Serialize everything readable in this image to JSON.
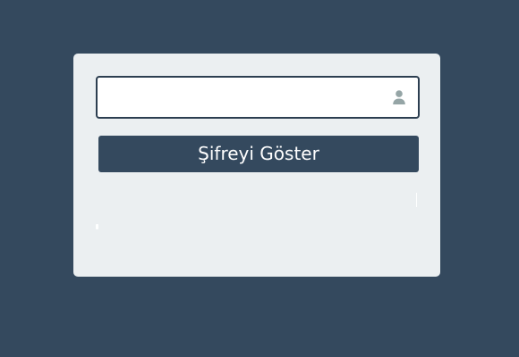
{
  "form": {
    "password_input": {
      "value": "",
      "placeholder": ""
    },
    "user_icon": "user-icon",
    "primary_button_label": "Şifreyi Göster"
  },
  "theme": {
    "background": "#34495e",
    "card": "#ebeff1",
    "button": "#34495e",
    "button_text": "#ffffff",
    "input_border": "#2c3e50",
    "icon": "#95a5a6"
  }
}
